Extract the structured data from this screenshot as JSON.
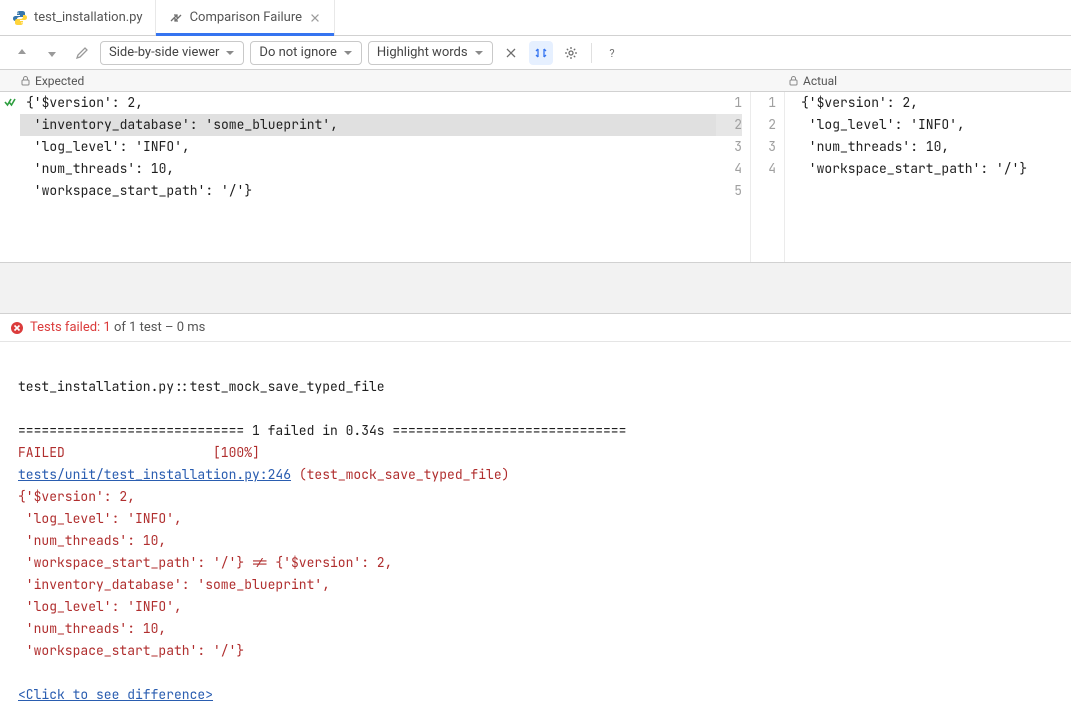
{
  "tabs": [
    {
      "label": "test_installation.py"
    },
    {
      "label": "Comparison Failure"
    }
  ],
  "toolbar": {
    "viewer_mode": "Side-by-side viewer",
    "ignore_mode": "Do not ignore",
    "highlight_mode": "Highlight words"
  },
  "diff": {
    "left_title": "Expected",
    "right_title": "Actual",
    "left_lines": [
      "{'$version': 2,",
      " 'inventory_database': 'some_blueprint',",
      " 'log_level': 'INFO',",
      " 'num_threads': 10,",
      " 'workspace_start_path': '/'}"
    ],
    "left_nums": [
      "1",
      "2",
      "3",
      "4",
      "5"
    ],
    "right_lines": [
      "{'$version': 2,",
      " 'log_level': 'INFO',",
      " 'num_threads': 10,",
      " 'workspace_start_path': '/'}"
    ],
    "right_nums": [
      "1",
      "2",
      "3",
      "4"
    ],
    "highlighted_left_index": 1
  },
  "test_status": {
    "prefix": "Tests failed: 1",
    "suffix": " of 1 test – 0 ms"
  },
  "console": {
    "lines": [
      {
        "t": "",
        "c": ""
      },
      {
        "t": "test_installation.py::test_mock_save_typed_file",
        "c": ""
      },
      {
        "t": "",
        "c": ""
      },
      {
        "t": "============================= 1 failed in 0.34s ==============================",
        "c": ""
      },
      {
        "t": "FAILED                   [100%]",
        "c": "c-red"
      },
      {
        "segments": [
          {
            "t": "tests/unit/test_installation.py:246",
            "c": "c-link"
          },
          {
            "t": " (test_mock_save_typed_file)",
            "c": "c-red"
          }
        ]
      },
      {
        "t": "{'$version': 2,",
        "c": "c-red"
      },
      {
        "t": " 'log_level': 'INFO',",
        "c": "c-red"
      },
      {
        "t": " 'num_threads': 10,",
        "c": "c-red"
      },
      {
        "t": " 'workspace_start_path': '/'} != {'$version': 2,",
        "c": "c-red"
      },
      {
        "t": " 'inventory_database': 'some_blueprint',",
        "c": "c-red"
      },
      {
        "t": " 'log_level': 'INFO',",
        "c": "c-red"
      },
      {
        "t": " 'num_threads': 10,",
        "c": "c-red"
      },
      {
        "t": " 'workspace_start_path': '/'}",
        "c": "c-red"
      },
      {
        "t": "",
        "c": ""
      },
      {
        "segments": [
          {
            "t": "<Click to see difference>",
            "c": "c-link"
          }
        ]
      }
    ]
  }
}
